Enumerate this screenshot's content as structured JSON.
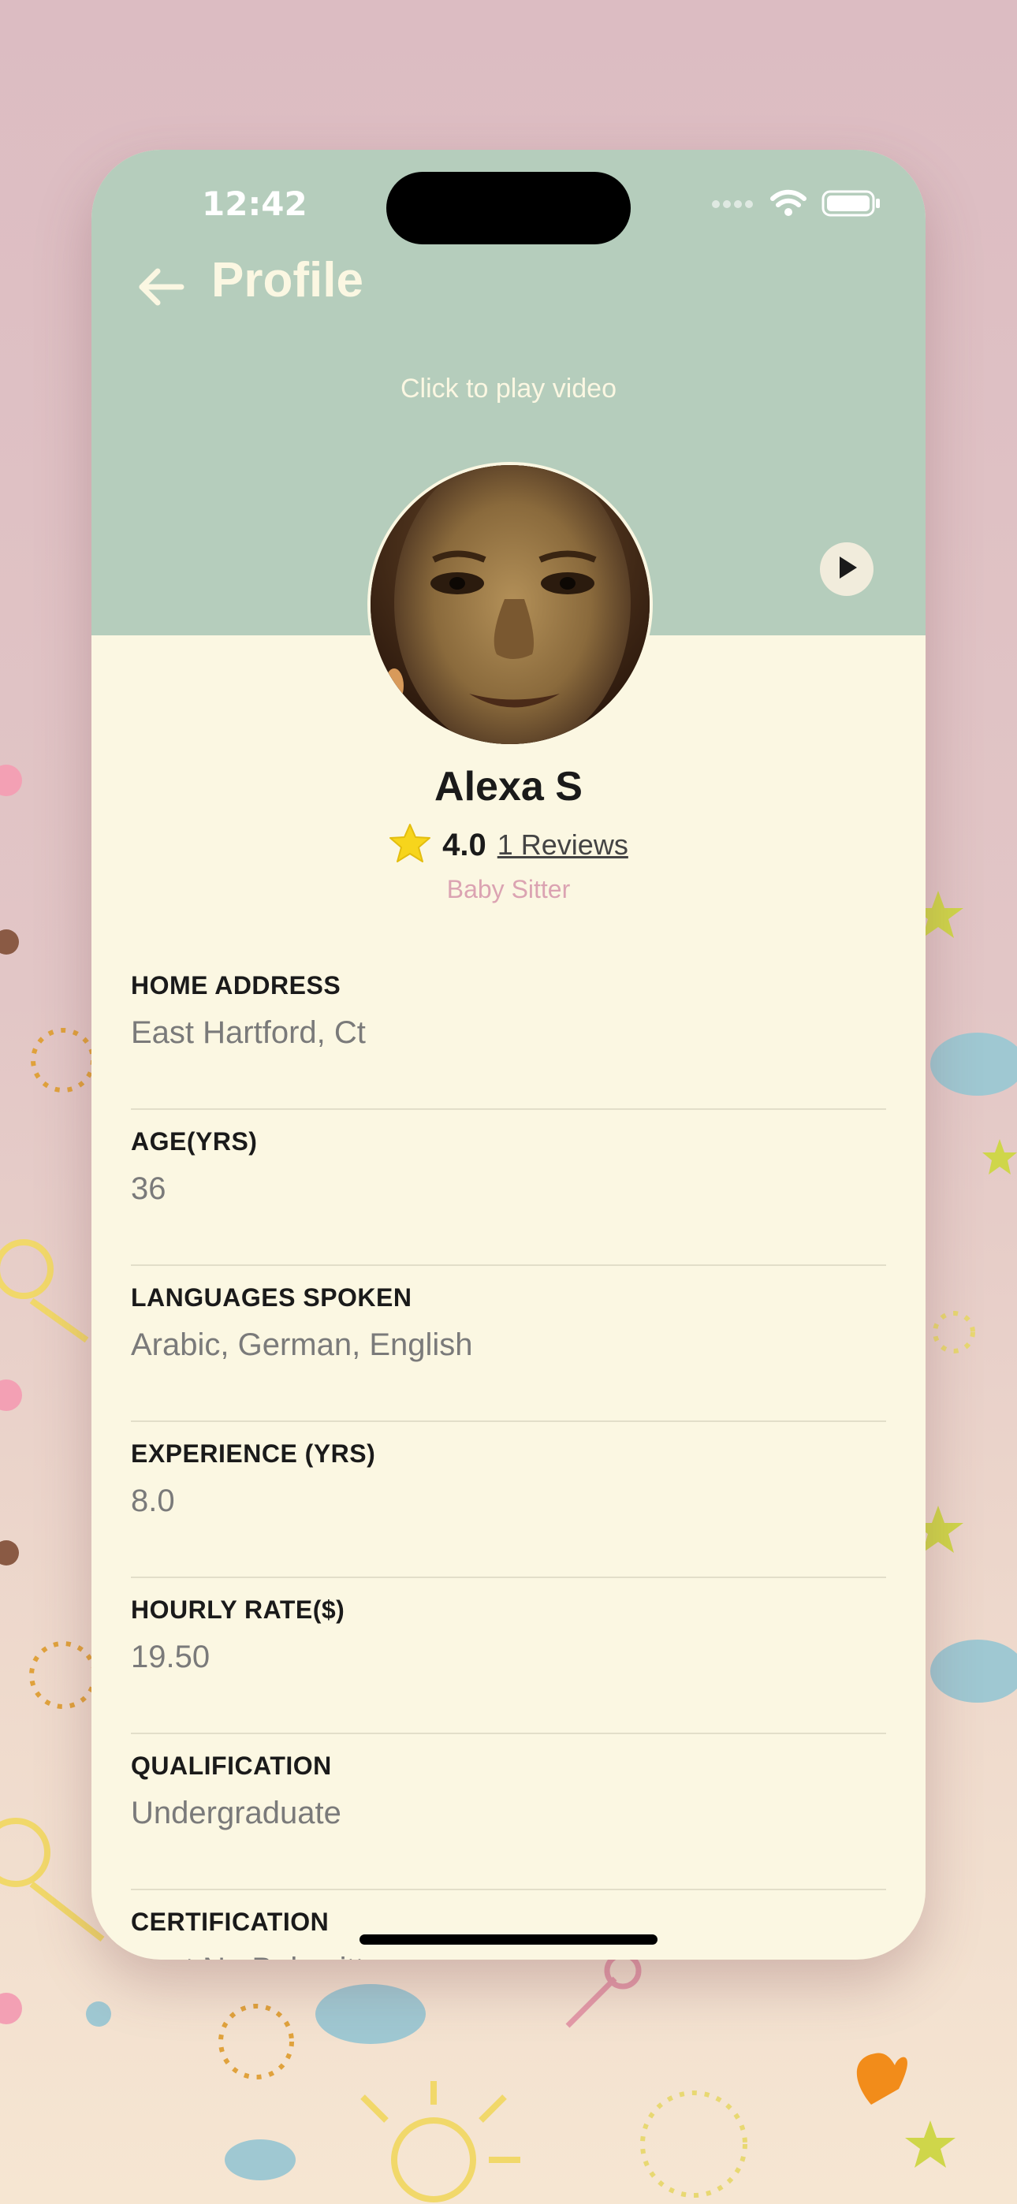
{
  "status_bar": {
    "time": "12:42"
  },
  "header": {
    "title": "Profile",
    "video_hint": "Click to play video"
  },
  "profile": {
    "name": "Alexa S",
    "rating": "4.0",
    "reviews_label": "1 Reviews",
    "role": "Baby Sitter"
  },
  "fields": [
    {
      "label": "HOME ADDRESS",
      "value": "East Hartford, Ct"
    },
    {
      "label": "AGE(YRS)",
      "value": "36"
    },
    {
      "label": "LANGUAGES SPOKEN",
      "value": "Arabic, German, English"
    },
    {
      "label": "EXPERIENCE (YRS)",
      "value": "8.0"
    },
    {
      "label": "HOURLY RATE($)",
      "value": "19.50"
    },
    {
      "label": "QUALIFICATION",
      "value": "Undergraduate"
    },
    {
      "label": "CERTIFICATION",
      "value": "Best Nu Babysitter"
    }
  ],
  "colors": {
    "header_green": "#b5cdbc",
    "card_cream": "#fbf7e2",
    "role_pink": "#dba3b2",
    "star_yellow": "#f7d51c"
  },
  "icons": [
    "back-arrow-icon",
    "play-icon",
    "star-icon",
    "wifi-icon",
    "battery-icon",
    "signal-icon"
  ]
}
